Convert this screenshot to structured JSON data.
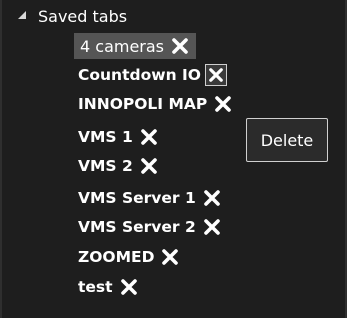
{
  "tree": {
    "root_label": "Saved tabs",
    "items": [
      {
        "label": "4 cameras",
        "selected": true
      },
      {
        "label": "Countdown IO",
        "selected": false
      },
      {
        "label": "INNOPOLI MAP",
        "selected": false
      },
      {
        "label": "VMS 1",
        "selected": false
      },
      {
        "label": "VMS 2",
        "selected": false
      },
      {
        "label": "VMS Server 1",
        "selected": false
      },
      {
        "label": "VMS Server 2",
        "selected": false
      },
      {
        "label": "ZOOMED",
        "selected": false
      },
      {
        "label": "test",
        "selected": false
      }
    ]
  },
  "tooltip": {
    "text": "Delete"
  },
  "icons": {
    "expand": "caret-down-icon",
    "delete": "close-icon"
  },
  "colors": {
    "background": "#1e1e1e",
    "selected": "#555555",
    "text": "#ffffff"
  }
}
